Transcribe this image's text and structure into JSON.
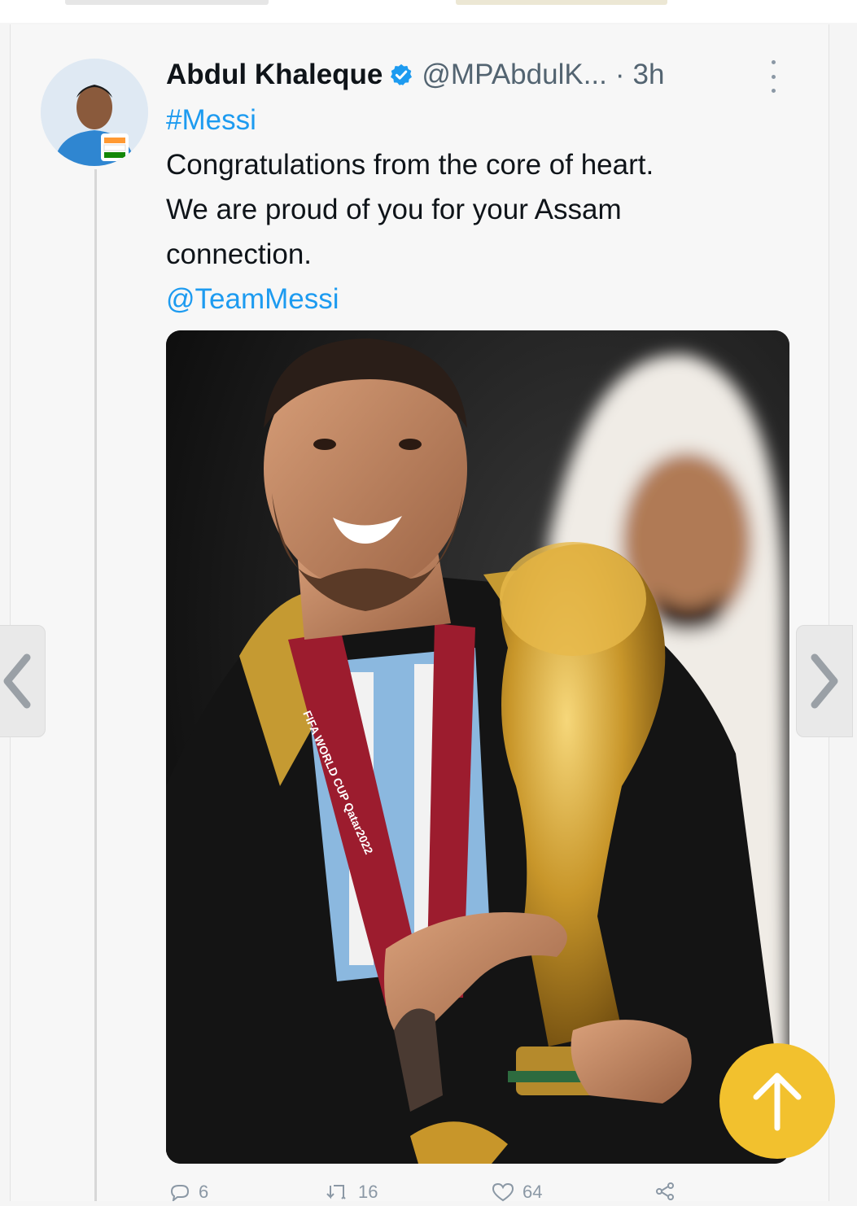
{
  "tweet": {
    "author_name": "Abdul Khaleque",
    "handle": "@MPAbdulK...",
    "separator": "·",
    "time": "3h",
    "hashtag": "#Messi",
    "text_lines": [
      "Congratulations from the core of heart.",
      "We are proud of you for your Assam",
      "connection."
    ],
    "mention": "@TeamMessi",
    "image_alt": "Messi holding the World Cup trophy wearing a black bisht and FIFA World Cup Qatar 2022 medal",
    "medal_ribbon_text": "FIFA WORLD CUP Qatar2022",
    "actions": {
      "reply_count": "6",
      "retweet_count": "16",
      "like_count": "64"
    }
  },
  "colors": {
    "link": "#1d9bf0",
    "verified": "#1d9bf0",
    "scroll_button": "#f2c12e"
  },
  "icons": {
    "verified": "verified-badge-icon",
    "more": "more-options-icon",
    "prev": "chevron-left-icon",
    "next": "chevron-right-icon",
    "scroll_top": "arrow-up-icon"
  }
}
